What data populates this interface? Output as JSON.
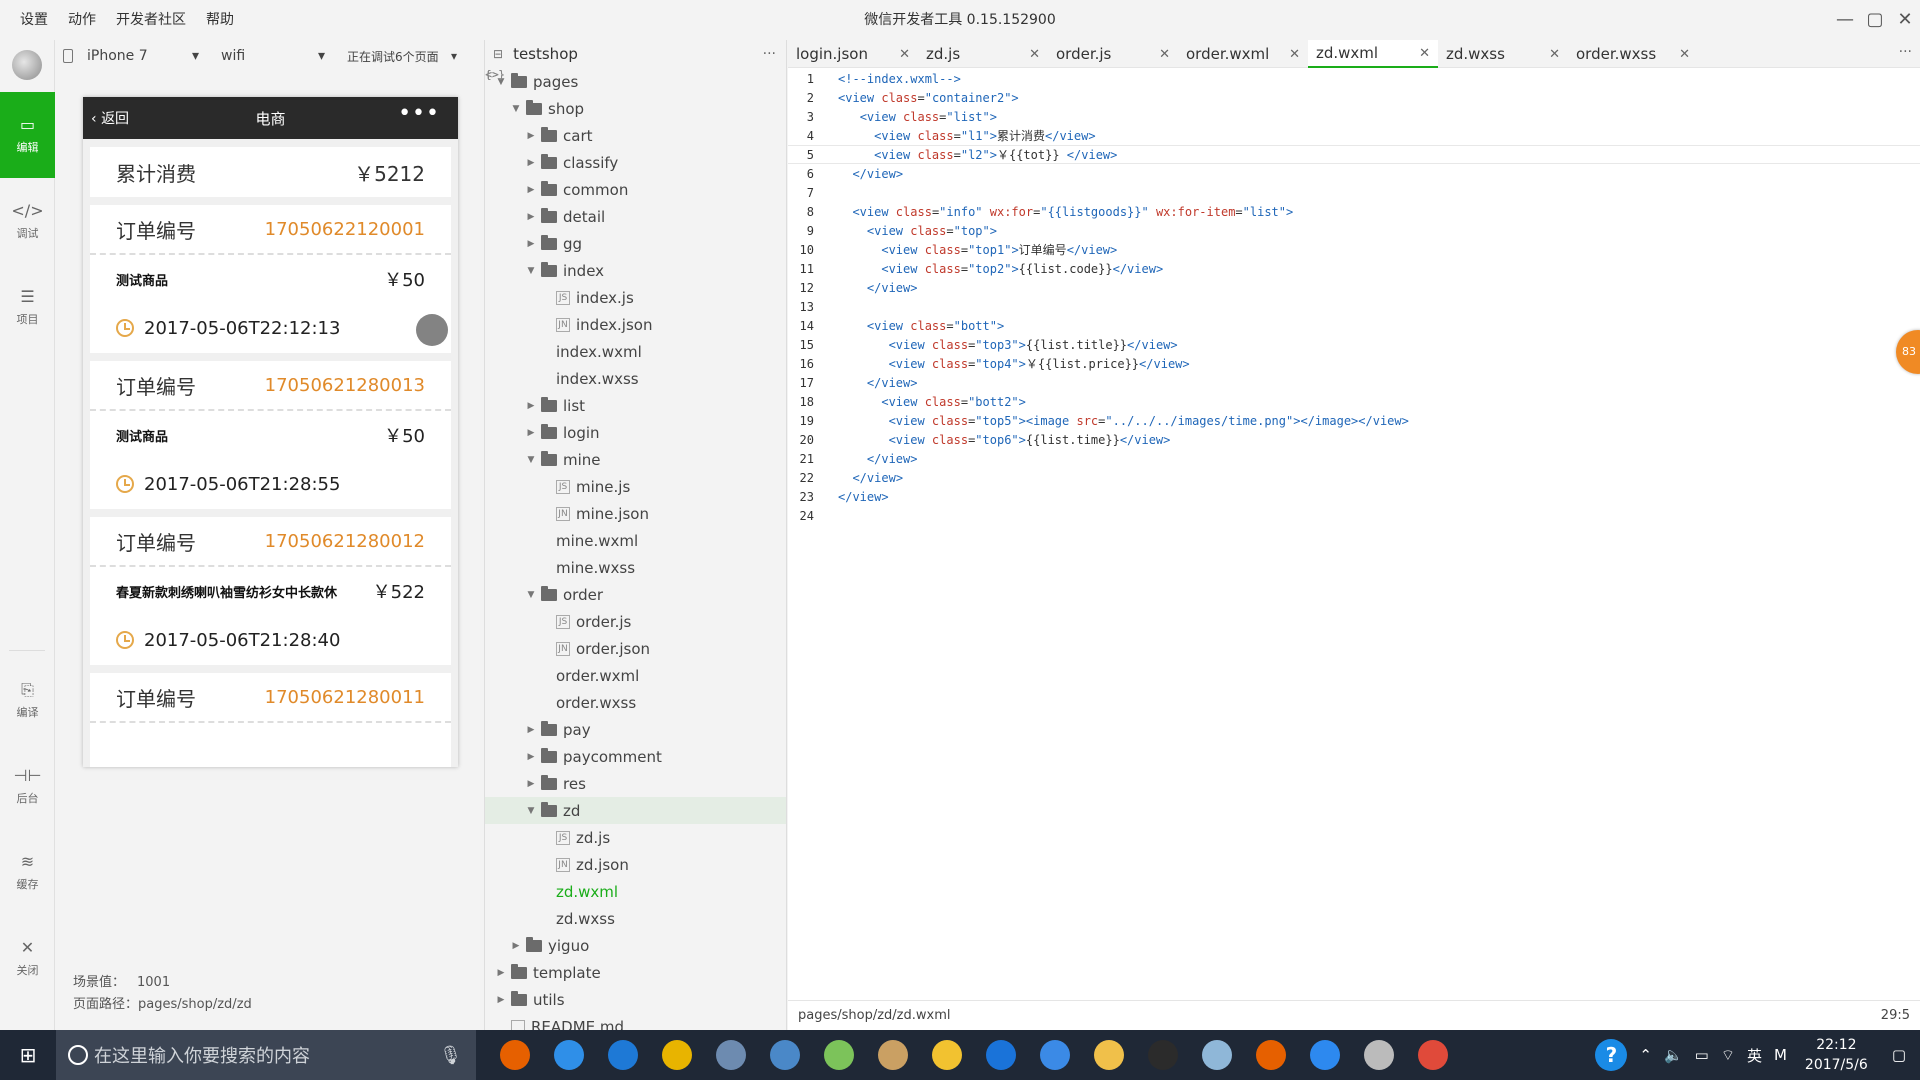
{
  "window": {
    "menu": [
      "设置",
      "动作",
      "开发者社区",
      "帮助"
    ],
    "title": "微信开发者工具 0.15.152900"
  },
  "leftbar": {
    "items": [
      {
        "label": "编辑",
        "icon": "code-icon"
      },
      {
        "label": "调试",
        "icon": "debug-icon"
      },
      {
        "label": "项目",
        "icon": "menu-icon"
      },
      {
        "label": "编译",
        "icon": "compile-icon"
      },
      {
        "label": "后台",
        "icon": "split-icon"
      },
      {
        "label": "缓存",
        "icon": "layers-icon"
      },
      {
        "label": "关闭",
        "icon": "close-icon"
      }
    ]
  },
  "simulator": {
    "device": "iPhone 7",
    "network": "wifi",
    "debug": "正在调试6个页面",
    "nav": {
      "back": "返回",
      "title": "电商"
    },
    "summary": {
      "label": "累计消费",
      "value": "￥5212"
    },
    "orders": [
      {
        "label": "订单编号",
        "code": "17050622120001",
        "product": "测试商品",
        "price": "￥50",
        "time": "2017-05-06T22:12:13"
      },
      {
        "label": "订单编号",
        "code": "17050621280013",
        "product": "测试商品",
        "price": "￥50",
        "time": "2017-05-06T21:28:55"
      },
      {
        "label": "订单编号",
        "code": "17050621280012",
        "product": "春夏新款刺绣喇叭袖雪纺衫女中长款休",
        "price": "￥522",
        "time": "2017-05-06T21:28:40"
      },
      {
        "label": "订单编号",
        "code": "17050621280011",
        "product": "",
        "price": "",
        "time": ""
      }
    ],
    "scene_label": "场景值：",
    "scene_value": "1001",
    "path_label": "页面路径：",
    "path_value": "pages/shop/zd/zd"
  },
  "filetree": {
    "project": "testshop",
    "nodes": [
      {
        "name": "pages",
        "type": "folder",
        "depth": 0,
        "open": true
      },
      {
        "name": "shop",
        "type": "folder",
        "depth": 1,
        "open": true
      },
      {
        "name": "cart",
        "type": "folder",
        "depth": 2,
        "open": false
      },
      {
        "name": "classify",
        "type": "folder",
        "depth": 2,
        "open": false
      },
      {
        "name": "common",
        "type": "folder",
        "depth": 2,
        "open": false
      },
      {
        "name": "detail",
        "type": "folder",
        "depth": 2,
        "open": false
      },
      {
        "name": "gg",
        "type": "folder",
        "depth": 2,
        "open": false
      },
      {
        "name": "index",
        "type": "folder",
        "depth": 2,
        "open": true
      },
      {
        "name": "index.js",
        "type": "js",
        "depth": 3
      },
      {
        "name": "index.json",
        "type": "json",
        "depth": 3
      },
      {
        "name": "index.wxml",
        "type": "wxml",
        "depth": 3
      },
      {
        "name": "index.wxss",
        "type": "wxss",
        "depth": 3
      },
      {
        "name": "list",
        "type": "folder",
        "depth": 2,
        "open": false
      },
      {
        "name": "login",
        "type": "folder",
        "depth": 2,
        "open": false
      },
      {
        "name": "mine",
        "type": "folder",
        "depth": 2,
        "open": true
      },
      {
        "name": "mine.js",
        "type": "js",
        "depth": 3
      },
      {
        "name": "mine.json",
        "type": "json",
        "depth": 3
      },
      {
        "name": "mine.wxml",
        "type": "wxml",
        "depth": 3
      },
      {
        "name": "mine.wxss",
        "type": "wxss",
        "depth": 3
      },
      {
        "name": "order",
        "type": "folder",
        "depth": 2,
        "open": true
      },
      {
        "name": "order.js",
        "type": "js",
        "depth": 3
      },
      {
        "name": "order.json",
        "type": "json",
        "depth": 3
      },
      {
        "name": "order.wxml",
        "type": "wxml",
        "depth": 3
      },
      {
        "name": "order.wxss",
        "type": "wxss",
        "depth": 3
      },
      {
        "name": "pay",
        "type": "folder",
        "depth": 2,
        "open": false
      },
      {
        "name": "paycomment",
        "type": "folder",
        "depth": 2,
        "open": false
      },
      {
        "name": "res",
        "type": "folder",
        "depth": 2,
        "open": false
      },
      {
        "name": "zd",
        "type": "folder",
        "depth": 2,
        "open": true,
        "selected": true
      },
      {
        "name": "zd.js",
        "type": "js",
        "depth": 3
      },
      {
        "name": "zd.json",
        "type": "json",
        "depth": 3
      },
      {
        "name": "zd.wxml",
        "type": "wxml",
        "depth": 3,
        "active": true
      },
      {
        "name": "zd.wxss",
        "type": "wxss",
        "depth": 3
      },
      {
        "name": "yiguo",
        "type": "folder",
        "depth": 1,
        "open": false
      },
      {
        "name": "template",
        "type": "folder",
        "depth": 0,
        "open": false
      },
      {
        "name": "utils",
        "type": "folder",
        "depth": 0,
        "open": false
      },
      {
        "name": "README.md",
        "type": "md",
        "depth": 0
      }
    ]
  },
  "editor": {
    "tabs": [
      {
        "label": "login.json",
        "active": false
      },
      {
        "label": "zd.js",
        "active": false
      },
      {
        "label": "order.js",
        "active": false
      },
      {
        "label": "order.wxml",
        "active": false
      },
      {
        "label": "zd.wxml",
        "active": true
      },
      {
        "label": "zd.wxss",
        "active": false
      },
      {
        "label": "order.wxss",
        "active": false
      }
    ],
    "lines": [
      "<!--index.wxml-->",
      "<view class=\"container2\">",
      "   <view class=\"list\">",
      "     <view class=\"l1\">累计消费</view>",
      "     <view class=\"l2\">￥{{tot}} </view>",
      "  </view>",
      "",
      "  <view class=\"info\" wx:for=\"{{listgoods}}\" wx:for-item=\"list\">",
      "    <view class=\"top\">",
      "      <view class=\"top1\">订单编号</view>",
      "      <view class=\"top2\">{{list.code}}</view>",
      "    </view>",
      "",
      "    <view class=\"bott\">",
      "       <view class=\"top3\">{{list.title}}</view>",
      "       <view class=\"top4\">￥{{list.price}}</view>",
      "    </view>",
      "      <view class=\"bott2\">",
      "       <view class=\"top5\"><image src=\"../../../images/time.png\"></image></view>",
      "       <view class=\"top6\">{{list.time}}</view>",
      "    </view>",
      "  </view>",
      "</view>",
      ""
    ],
    "current_line": 5,
    "status_path": "pages/shop/zd/zd.wxml",
    "cursor": "29:5",
    "badge": "83"
  },
  "taskbar": {
    "search_placeholder": "在这里输入你要搜索的内容",
    "apps": [
      {
        "name": "firefox-icon",
        "color": "#e66000"
      },
      {
        "name": "app-blue-s-icon",
        "color": "#2f8fe8"
      },
      {
        "name": "edge-icon",
        "color": "#1e79d6"
      },
      {
        "name": "chrome-icon",
        "color": "#e8b400"
      },
      {
        "name": "app-globe-icon",
        "color": "#6d8bb0"
      },
      {
        "name": "app-feather-icon",
        "color": "#4a88c8"
      },
      {
        "name": "app-leaf-icon",
        "color": "#7cc35a"
      },
      {
        "name": "app-photo-icon",
        "color": "#caa063"
      },
      {
        "name": "app-chat-icon",
        "color": "#f2c230"
      },
      {
        "name": "app-k-icon",
        "color": "#1a73d9"
      },
      {
        "name": "app-network-icon",
        "color": "#3b8ae6"
      },
      {
        "name": "explorer-icon",
        "color": "#f0c04a"
      },
      {
        "name": "wechat-devtools-icon",
        "color": "#2b2b2b"
      },
      {
        "name": "app-notebook-icon",
        "color": "#8fb7d8"
      },
      {
        "name": "firefox-dev-icon",
        "color": "#e66000"
      },
      {
        "name": "app-cloud-icon",
        "color": "#2d89ef"
      },
      {
        "name": "settings-gear-icon",
        "color": "#bbbbbb"
      },
      {
        "name": "app-red-icon",
        "color": "#e04a3a"
      }
    ],
    "tray": {
      "ime": "英",
      "ime2": "M"
    },
    "time": "22:12",
    "date": "2017/5/6"
  }
}
